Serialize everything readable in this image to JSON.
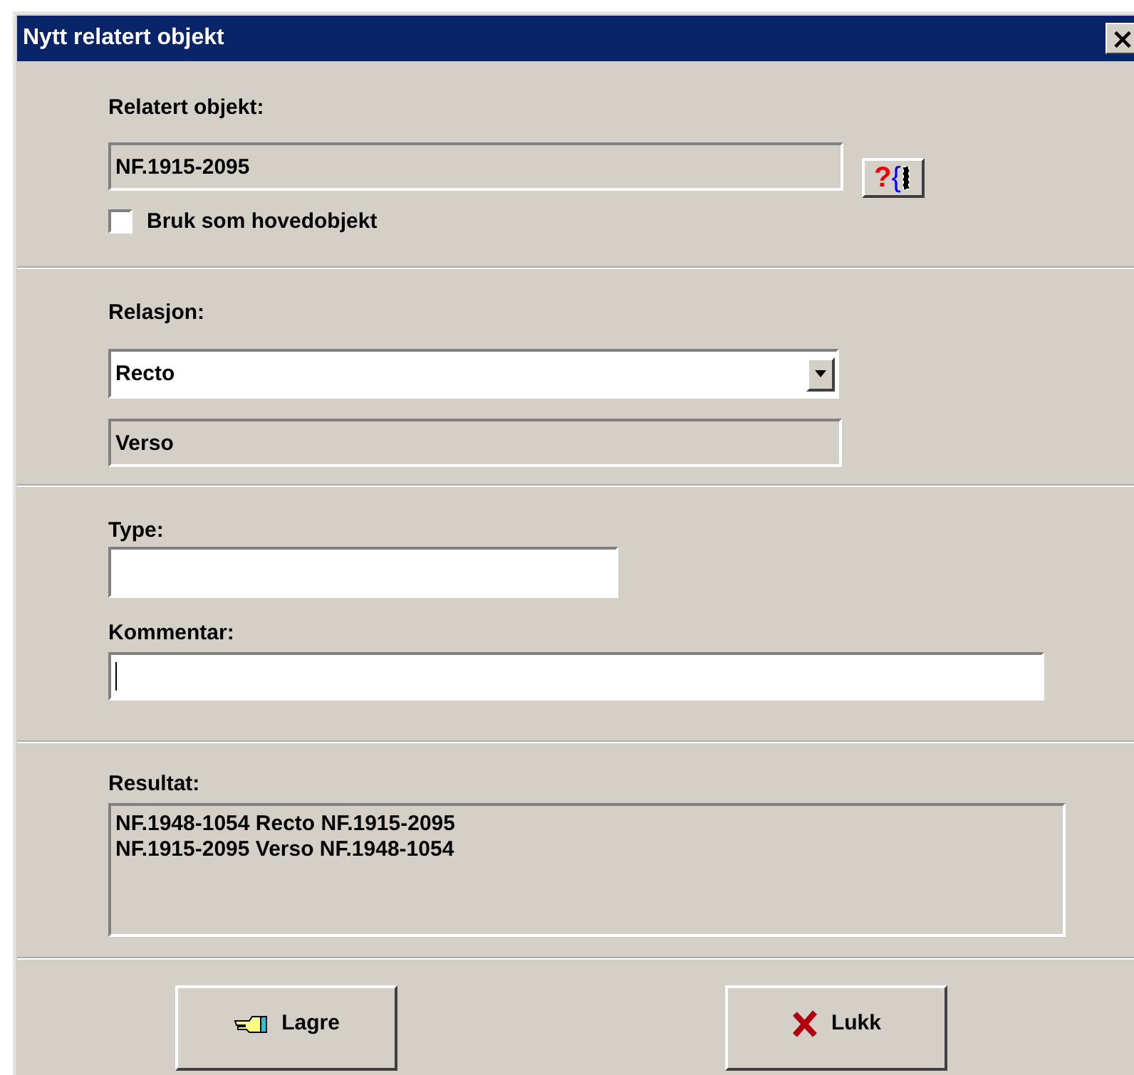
{
  "window": {
    "title": "Nytt relatert objekt",
    "close": "×"
  },
  "related_object": {
    "label": "Relatert objekt:",
    "value": "NF.1915-2095",
    "lookup_button": "?{"
  },
  "main_object_checkbox": {
    "label": "Bruk som hovedobjekt",
    "checked": false
  },
  "relation": {
    "label": "Relasjon:",
    "value": "Recto",
    "inverse": "Verso"
  },
  "type": {
    "label": "Type:"
  },
  "comment": {
    "label": "Kommentar:",
    "focused": true
  },
  "result": {
    "label": "Resultat:",
    "lines": [
      "NF.1948-1054 Recto NF.1915-2095",
      "NF.1915-2095 Verso NF.1948-1054"
    ]
  },
  "buttons": [
    {
      "label": "Lagre",
      "kind": "save"
    },
    {
      "label": "Lukk",
      "kind": "close"
    }
  ]
}
